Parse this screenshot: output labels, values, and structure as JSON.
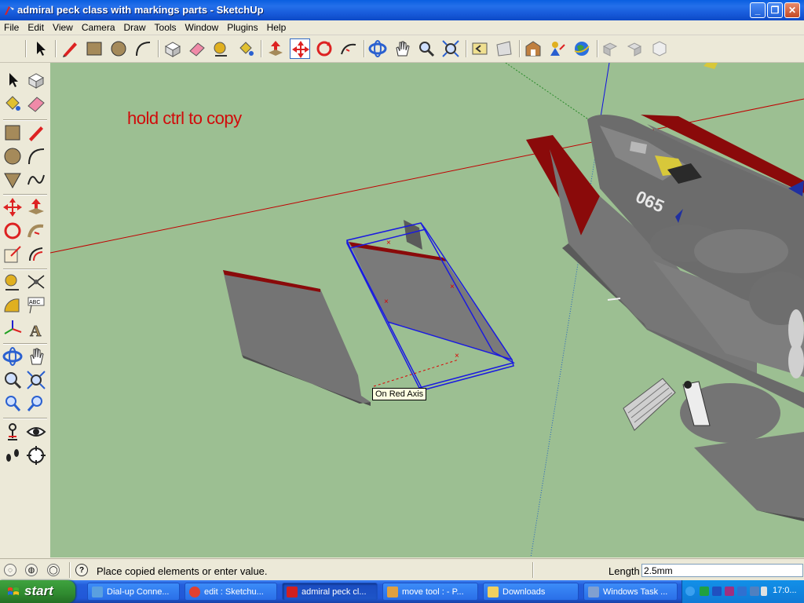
{
  "window": {
    "title": "admiral peck class with markings parts - SketchUp",
    "minimize": "_",
    "maximize": "❐",
    "close": "✕"
  },
  "menu": [
    "File",
    "Edit",
    "View",
    "Camera",
    "Draw",
    "Tools",
    "Window",
    "Plugins",
    "Help"
  ],
  "viewport": {
    "hint_text": "hold ctrl to copy",
    "tooltip": "On Red Axis",
    "axis_colors": {
      "red": "#c00000",
      "green": "#00a000",
      "blue": "#0000e0"
    },
    "background": "#9cbf92"
  },
  "statusbar": {
    "icons": [
      "geo-location-icon",
      "credits-icon",
      "help-circle-icon"
    ],
    "message": "Place copied elements or enter value.",
    "length_label": "Length",
    "length_value": "2.5mm"
  },
  "taskbar": {
    "start_label": "start",
    "tasks": [
      {
        "label": "Dial-up Conne...",
        "icon": "dialup-icon",
        "color": "#5aa0e0"
      },
      {
        "label": "edit : Sketchu...",
        "icon": "chrome-icon",
        "color": "#e04030"
      },
      {
        "label": "admiral peck cl...",
        "icon": "sketchup-icon",
        "color": "#d02020",
        "active": true
      },
      {
        "label": "move tool : - P...",
        "icon": "browser-icon",
        "color": "#e0a040"
      },
      {
        "label": "Downloads",
        "icon": "folder-icon",
        "color": "#f0d060"
      },
      {
        "label": "Windows Task ...",
        "icon": "task-manager-icon",
        "color": "#80a0d0"
      }
    ],
    "clock": "17:0..."
  }
}
